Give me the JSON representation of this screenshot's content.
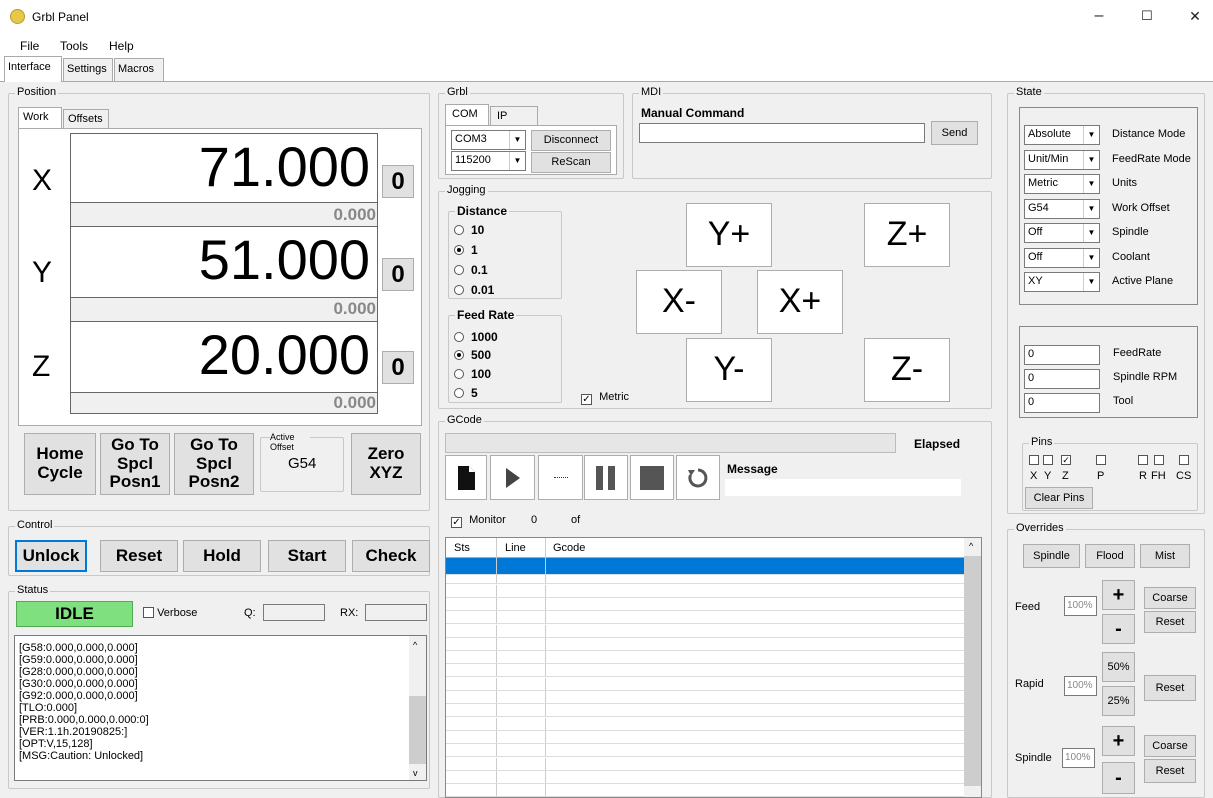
{
  "window": {
    "title": "Grbl Panel",
    "min": "–",
    "max": "☐",
    "close": "✕"
  },
  "menu": [
    "File",
    "Tools",
    "Help"
  ],
  "main_tabs": [
    "Interface",
    "Settings",
    "Macros"
  ],
  "position": {
    "label": "Position",
    "tabs": [
      "Work",
      "Offsets"
    ],
    "axes": [
      {
        "name": "X",
        "value": "71.000",
        "machine": "0.000",
        "zero": "0"
      },
      {
        "name": "Y",
        "value": "51.000",
        "machine": "0.000",
        "zero": "0"
      },
      {
        "name": "Z",
        "value": "20.000",
        "machine": "0.000",
        "zero": "0"
      }
    ],
    "home_cycle": "Home Cycle",
    "goto1": "Go To Spcl Posn1",
    "goto2": "Go To Spcl Posn2",
    "active_offset_label": "Active Offset",
    "active_offset_value": "G54",
    "zero_xyz": "Zero XYZ"
  },
  "control": {
    "label": "Control",
    "buttons": [
      "Unlock",
      "Reset",
      "Hold",
      "Start",
      "Check"
    ]
  },
  "status": {
    "label": "Status",
    "state": "IDLE",
    "state_color": "#7ee07e",
    "verbose": "Verbose",
    "q_label": "Q:",
    "rx_label": "RX:",
    "log": [
      "[G58:0.000,0.000,0.000]",
      "[G59:0.000,0.000,0.000]",
      "[G28:0.000,0.000,0.000]",
      "[G30:0.000,0.000,0.000]",
      "[G92:0.000,0.000,0.000]",
      "[TLO:0.000]",
      "[PRB:0.000,0.000,0.000:0]",
      "[VER:1.1h.20190825:]",
      "[OPT:V,15,128]",
      "[MSG:Caution: Unlocked]"
    ]
  },
  "grbl": {
    "label": "Grbl",
    "tabs": [
      "COM",
      "IP"
    ],
    "port": "COM3",
    "baud": "115200",
    "disconnect": "Disconnect",
    "rescan": "ReScan"
  },
  "mdi": {
    "label": "MDI",
    "heading": "Manual Command",
    "value": "",
    "send": "Send"
  },
  "jogging": {
    "label": "Jogging",
    "distance_label": "Distance",
    "distances": [
      "10",
      "1",
      "0.1",
      "0.01"
    ],
    "distance_selected": 1,
    "feed_label": "Feed Rate",
    "feeds": [
      "1000",
      "500",
      "100",
      "5"
    ],
    "feed_selected": 1,
    "metric": "Metric",
    "buttons": {
      "yplus": "Y+",
      "zplus": "Z+",
      "xminus": "X-",
      "xplus": "X+",
      "yminus": "Y-",
      "zminus": "Z-"
    }
  },
  "gcode": {
    "label": "GCode",
    "elapsed": "Elapsed",
    "message": "Message",
    "monitor": "Monitor",
    "line_count": "0",
    "of": "of",
    "columns": [
      "Sts",
      "Line",
      "Gcode"
    ],
    "highlight_color": "#0078d7"
  },
  "state": {
    "label": "State",
    "modes": [
      {
        "value": "Absolute",
        "label": "Distance Mode"
      },
      {
        "value": "Unit/Min",
        "label": "FeedRate Mode"
      },
      {
        "value": "Metric",
        "label": "Units"
      },
      {
        "value": "G54",
        "label": "Work Offset"
      },
      {
        "value": "Off",
        "label": "Spindle"
      },
      {
        "value": "Off",
        "label": "Coolant"
      },
      {
        "value": "XY",
        "label": "Active Plane"
      }
    ],
    "values": [
      {
        "value": "0",
        "label": "FeedRate"
      },
      {
        "value": "0",
        "label": "Spindle RPM"
      },
      {
        "value": "0",
        "label": "Tool"
      }
    ],
    "pins_label": "Pins",
    "pins": [
      "X",
      "Y",
      "Z",
      "P",
      "R",
      "FH",
      "CS"
    ],
    "clear_pins": "Clear Pins"
  },
  "overrides": {
    "label": "Overrides",
    "spindle_btn": "Spindle",
    "flood_btn": "Flood",
    "mist_btn": "Mist",
    "feed_label": "Feed",
    "feed_value": "100%",
    "plus": "+",
    "minus": "-",
    "coarse": "Coarse",
    "reset": "Reset",
    "rapid_label": "Rapid",
    "rapid_value": "100%",
    "p50": "50%",
    "p25": "25%",
    "spindle_label": "Spindle",
    "spindle_value": "100%"
  }
}
